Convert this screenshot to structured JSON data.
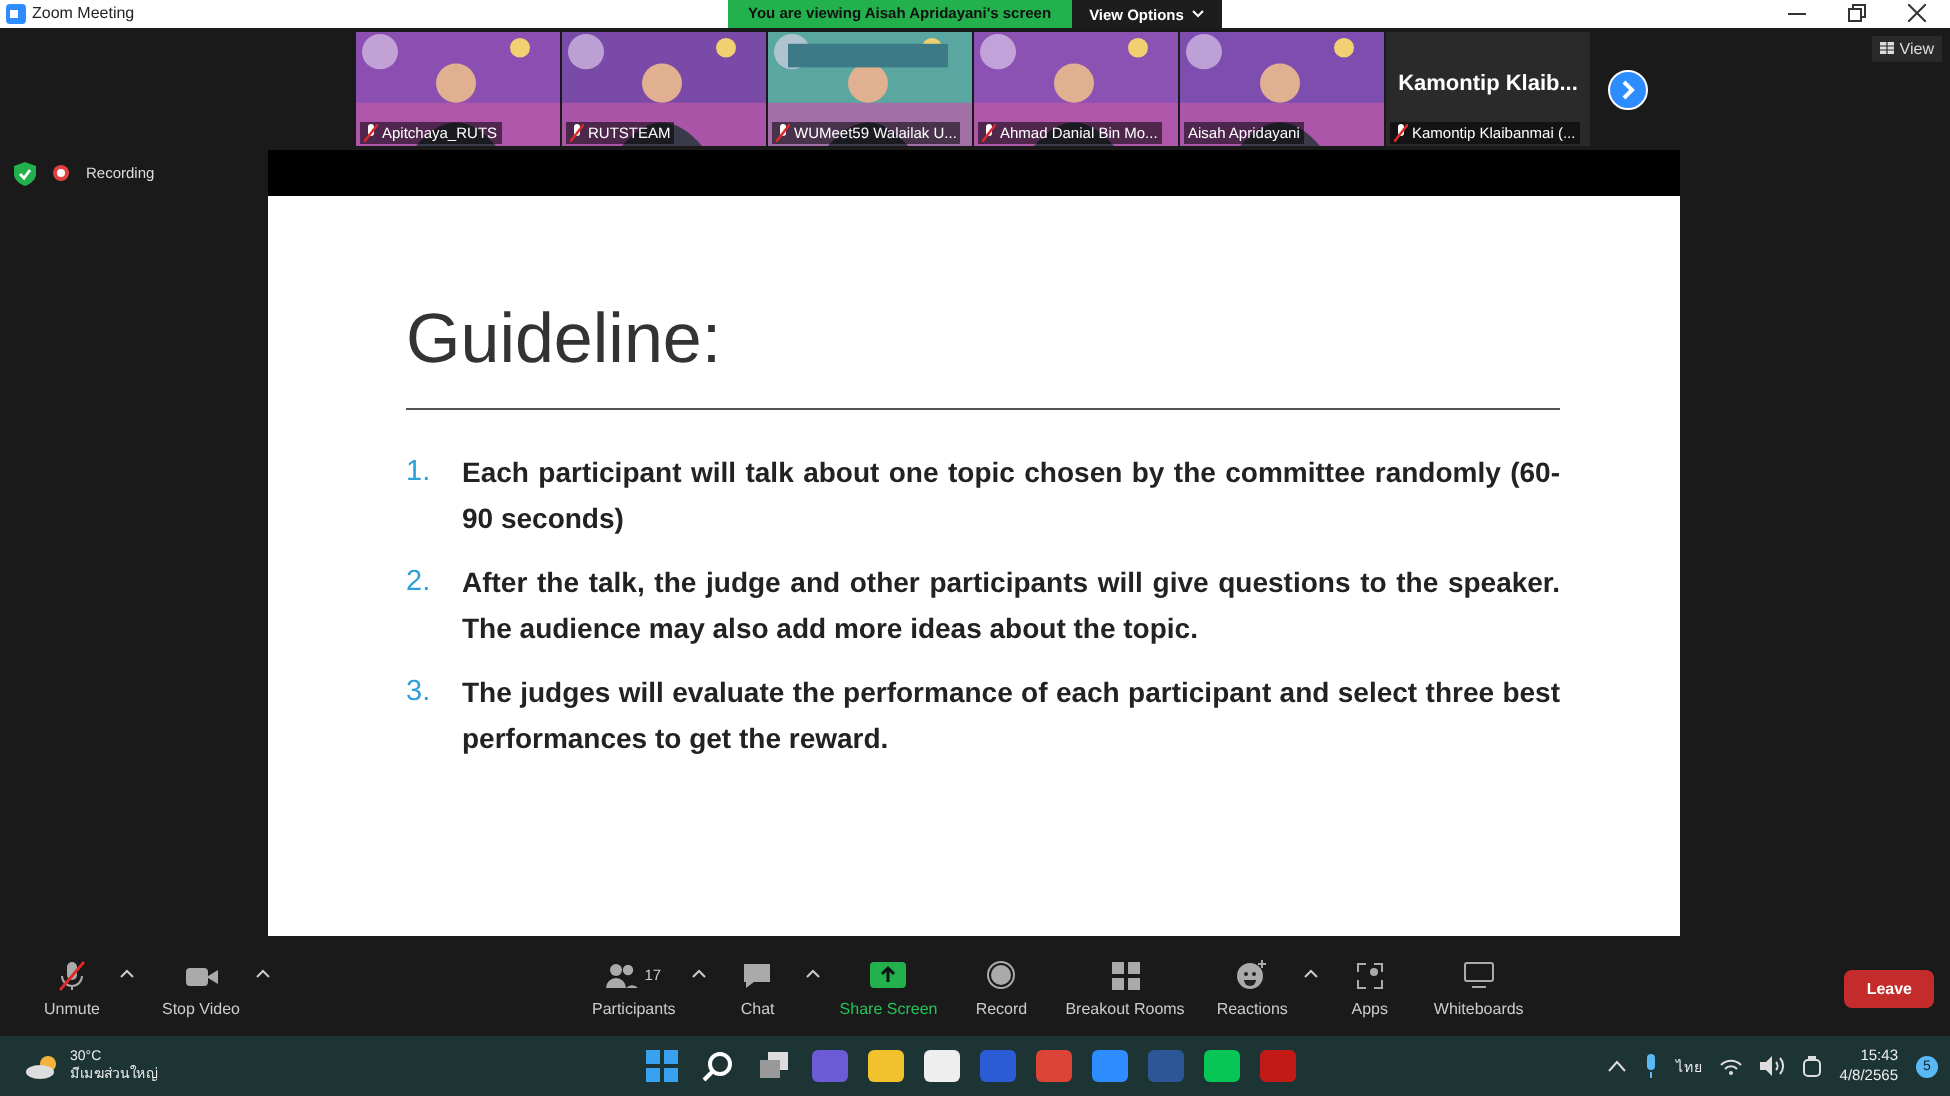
{
  "window": {
    "title": "Zoom Meeting"
  },
  "share_banner": {
    "text": "You are viewing Aisah Apridayani's screen",
    "button": "View Options"
  },
  "view_button": "View",
  "participants_strip": [
    {
      "name": "Apitchaya_RUTS",
      "kind": "picture",
      "muted": true
    },
    {
      "name": "RUTSTEAM",
      "kind": "picture",
      "muted": true
    },
    {
      "name": "WUMeet59 Walailak U...",
      "kind": "picture",
      "muted": true
    },
    {
      "name": "Ahmad Danial Bin Mo...",
      "kind": "picture",
      "muted": true
    },
    {
      "name": "Aisah Apridayani",
      "kind": "picture",
      "muted": false
    },
    {
      "name": "Kamontip Klaibanmai (...",
      "kind": "name",
      "display": "Kamontip  Klaib...",
      "muted": true
    }
  ],
  "recording": {
    "label": "Recording"
  },
  "slide": {
    "title": "Guideline:",
    "items": [
      {
        "number": "1.",
        "text": "Each participant will talk about one topic chosen by the committee randomly  (60-90 seconds)"
      },
      {
        "number": "2.",
        "text": "After the talk, the judge and other participants will give questions to the speaker. The audience may also add more ideas about the topic."
      },
      {
        "number": "3.",
        "text": "The judges will evaluate the performance of each participant and select three best performances to get the reward."
      }
    ]
  },
  "toolbar": {
    "left": [
      {
        "label": "Unmute",
        "caret": true
      },
      {
        "label": "Stop Video",
        "caret": true
      }
    ],
    "center": [
      {
        "label": "Participants",
        "count": "17",
        "caret": true
      },
      {
        "label": "Chat",
        "caret": true
      },
      {
        "label": "Share Screen",
        "caret": false
      },
      {
        "label": "Record",
        "caret": false
      },
      {
        "label": "Breakout Rooms",
        "caret": false
      },
      {
        "label": "Reactions",
        "caret": true
      },
      {
        "label": "Apps",
        "caret": false
      },
      {
        "label": "Whiteboards",
        "caret": false
      }
    ],
    "leave": "Leave"
  },
  "taskbar": {
    "weather": {
      "temp": "30°C",
      "condition": "มีเมฆส่วนใหญ่"
    },
    "language": "ไทย",
    "time": "15:43",
    "date": "4/8/2565",
    "badge": "5"
  }
}
